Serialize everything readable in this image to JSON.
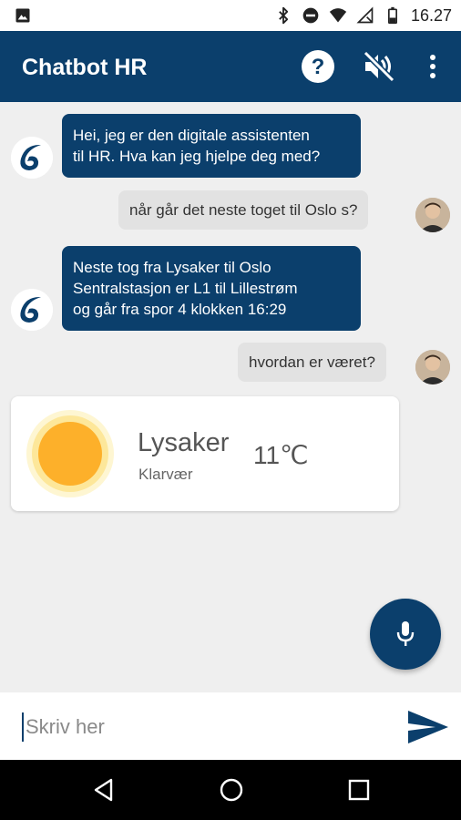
{
  "status_bar": {
    "time": "16.27",
    "icons": [
      "image-icon",
      "bluetooth-icon",
      "do-not-disturb-icon",
      "wifi-icon",
      "no-signal-icon",
      "battery-icon"
    ]
  },
  "app_bar": {
    "title": "Chatbot HR",
    "icons": [
      "help-icon",
      "volume-off-icon",
      "more-vert-icon"
    ]
  },
  "messages": [
    {
      "sender": "bot",
      "lines": [
        "Hei, jeg er den digitale assistenten",
        "til HR. Hva kan jeg hjelpe deg med?"
      ]
    },
    {
      "sender": "user",
      "text": "når går det neste toget til Oslo s?"
    },
    {
      "sender": "bot",
      "lines": [
        "Neste tog fra Lysaker til Oslo",
        "Sentralstasjon  er L1 til Lillestrøm",
        "og går fra spor 4 klokken 16:29"
      ]
    },
    {
      "sender": "user",
      "text": "hvordan er været?"
    }
  ],
  "weather": {
    "location": "Lysaker",
    "condition": "Klarvær",
    "temperature": "11℃",
    "icon": "sun-icon"
  },
  "input": {
    "placeholder": "Skriv her",
    "value": ""
  },
  "colors": {
    "primary": "#0b3f6c",
    "bot_bubble": "#0b3f6c",
    "user_bubble": "#e2e2e2",
    "background": "#efefef",
    "sun": "#fdb02a"
  }
}
